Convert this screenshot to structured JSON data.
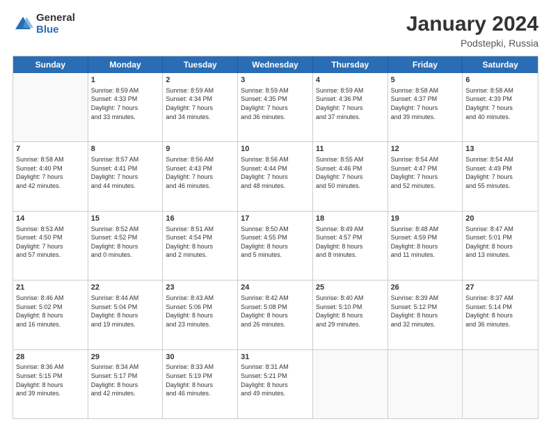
{
  "logo": {
    "general": "General",
    "blue": "Blue"
  },
  "title": "January 2024",
  "location": "Podstepki, Russia",
  "days": [
    "Sunday",
    "Monday",
    "Tuesday",
    "Wednesday",
    "Thursday",
    "Friday",
    "Saturday"
  ],
  "weeks": [
    [
      {
        "day": "",
        "info": ""
      },
      {
        "day": "1",
        "info": "Sunrise: 8:59 AM\nSunset: 4:33 PM\nDaylight: 7 hours\nand 33 minutes."
      },
      {
        "day": "2",
        "info": "Sunrise: 8:59 AM\nSunset: 4:34 PM\nDaylight: 7 hours\nand 34 minutes."
      },
      {
        "day": "3",
        "info": "Sunrise: 8:59 AM\nSunset: 4:35 PM\nDaylight: 7 hours\nand 36 minutes."
      },
      {
        "day": "4",
        "info": "Sunrise: 8:59 AM\nSunset: 4:36 PM\nDaylight: 7 hours\nand 37 minutes."
      },
      {
        "day": "5",
        "info": "Sunrise: 8:58 AM\nSunset: 4:37 PM\nDaylight: 7 hours\nand 39 minutes."
      },
      {
        "day": "6",
        "info": "Sunrise: 8:58 AM\nSunset: 4:39 PM\nDaylight: 7 hours\nand 40 minutes."
      }
    ],
    [
      {
        "day": "7",
        "info": "Sunrise: 8:58 AM\nSunset: 4:40 PM\nDaylight: 7 hours\nand 42 minutes."
      },
      {
        "day": "8",
        "info": "Sunrise: 8:57 AM\nSunset: 4:41 PM\nDaylight: 7 hours\nand 44 minutes."
      },
      {
        "day": "9",
        "info": "Sunrise: 8:56 AM\nSunset: 4:43 PM\nDaylight: 7 hours\nand 46 minutes."
      },
      {
        "day": "10",
        "info": "Sunrise: 8:56 AM\nSunset: 4:44 PM\nDaylight: 7 hours\nand 48 minutes."
      },
      {
        "day": "11",
        "info": "Sunrise: 8:55 AM\nSunset: 4:46 PM\nDaylight: 7 hours\nand 50 minutes."
      },
      {
        "day": "12",
        "info": "Sunrise: 8:54 AM\nSunset: 4:47 PM\nDaylight: 7 hours\nand 52 minutes."
      },
      {
        "day": "13",
        "info": "Sunrise: 8:54 AM\nSunset: 4:49 PM\nDaylight: 7 hours\nand 55 minutes."
      }
    ],
    [
      {
        "day": "14",
        "info": "Sunrise: 8:53 AM\nSunset: 4:50 PM\nDaylight: 7 hours\nand 57 minutes."
      },
      {
        "day": "15",
        "info": "Sunrise: 8:52 AM\nSunset: 4:52 PM\nDaylight: 8 hours\nand 0 minutes."
      },
      {
        "day": "16",
        "info": "Sunrise: 8:51 AM\nSunset: 4:54 PM\nDaylight: 8 hours\nand 2 minutes."
      },
      {
        "day": "17",
        "info": "Sunrise: 8:50 AM\nSunset: 4:55 PM\nDaylight: 8 hours\nand 5 minutes."
      },
      {
        "day": "18",
        "info": "Sunrise: 8:49 AM\nSunset: 4:57 PM\nDaylight: 8 hours\nand 8 minutes."
      },
      {
        "day": "19",
        "info": "Sunrise: 8:48 AM\nSunset: 4:59 PM\nDaylight: 8 hours\nand 11 minutes."
      },
      {
        "day": "20",
        "info": "Sunrise: 8:47 AM\nSunset: 5:01 PM\nDaylight: 8 hours\nand 13 minutes."
      }
    ],
    [
      {
        "day": "21",
        "info": "Sunrise: 8:46 AM\nSunset: 5:02 PM\nDaylight: 8 hours\nand 16 minutes."
      },
      {
        "day": "22",
        "info": "Sunrise: 8:44 AM\nSunset: 5:04 PM\nDaylight: 8 hours\nand 19 minutes."
      },
      {
        "day": "23",
        "info": "Sunrise: 8:43 AM\nSunset: 5:06 PM\nDaylight: 8 hours\nand 23 minutes."
      },
      {
        "day": "24",
        "info": "Sunrise: 8:42 AM\nSunset: 5:08 PM\nDaylight: 8 hours\nand 26 minutes."
      },
      {
        "day": "25",
        "info": "Sunrise: 8:40 AM\nSunset: 5:10 PM\nDaylight: 8 hours\nand 29 minutes."
      },
      {
        "day": "26",
        "info": "Sunrise: 8:39 AM\nSunset: 5:12 PM\nDaylight: 8 hours\nand 32 minutes."
      },
      {
        "day": "27",
        "info": "Sunrise: 8:37 AM\nSunset: 5:14 PM\nDaylight: 8 hours\nand 36 minutes."
      }
    ],
    [
      {
        "day": "28",
        "info": "Sunrise: 8:36 AM\nSunset: 5:15 PM\nDaylight: 8 hours\nand 39 minutes."
      },
      {
        "day": "29",
        "info": "Sunrise: 8:34 AM\nSunset: 5:17 PM\nDaylight: 8 hours\nand 42 minutes."
      },
      {
        "day": "30",
        "info": "Sunrise: 8:33 AM\nSunset: 5:19 PM\nDaylight: 8 hours\nand 46 minutes."
      },
      {
        "day": "31",
        "info": "Sunrise: 8:31 AM\nSunset: 5:21 PM\nDaylight: 8 hours\nand 49 minutes."
      },
      {
        "day": "",
        "info": ""
      },
      {
        "day": "",
        "info": ""
      },
      {
        "day": "",
        "info": ""
      }
    ]
  ]
}
